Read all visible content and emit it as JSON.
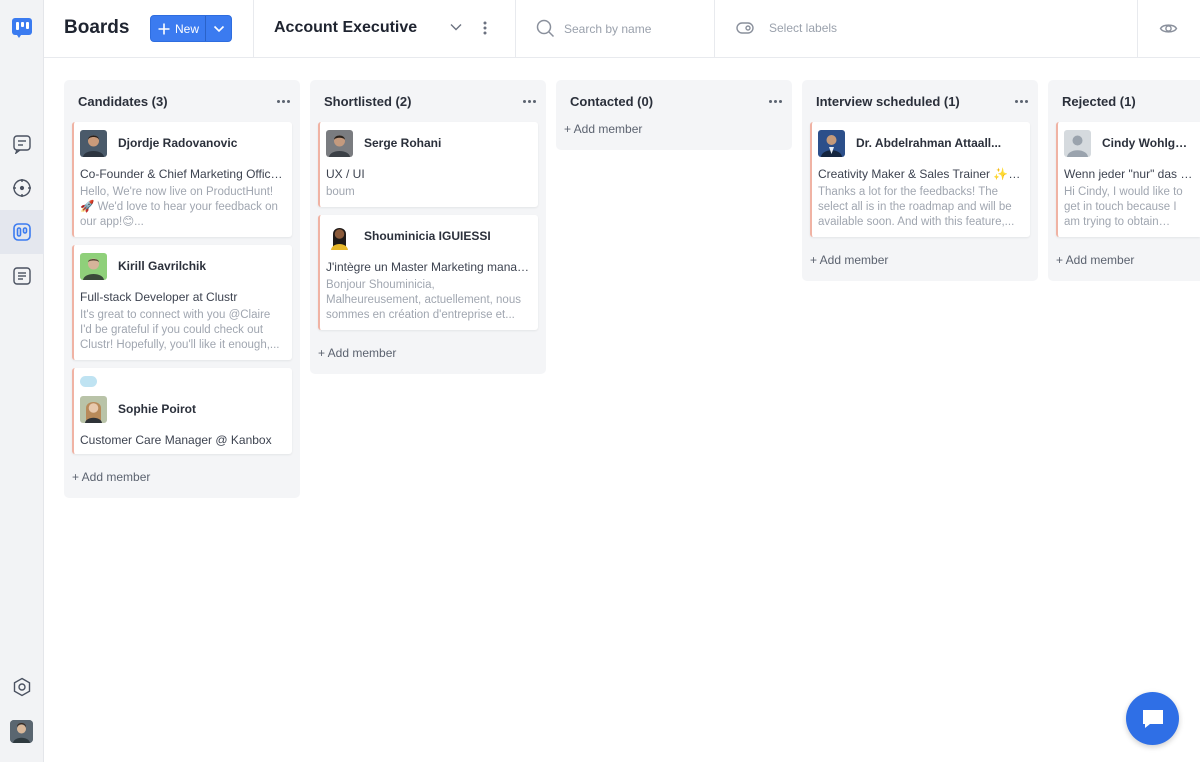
{
  "rail": {
    "icons": [
      "logo-icon",
      "messages-icon",
      "compass-icon",
      "boards-icon",
      "notes-icon",
      "settings-icon"
    ],
    "accent": "#3b7bf0"
  },
  "header": {
    "title": "Boards",
    "new_label": "New",
    "board_name": "Account Executive",
    "search_placeholder": "Search by name",
    "labels_placeholder": "Select labels"
  },
  "columns": [
    {
      "title": "Candidates (3)",
      "add_label": "+ Add member",
      "cards": [
        {
          "name": "Djordje Radovanovic",
          "role": "Co-Founder & Chief Marketing Officer...",
          "message": "Hello, We're now live on ProductHunt! 🚀 We'd love to hear your feedback on our app!😊...",
          "avatar_color": "#4a5a6a"
        },
        {
          "name": "Kirill Gavrilchik",
          "role": "Full-stack Developer at Clustr",
          "message": "It's great to connect with you @Claire I'd be grateful if you could check out Clustr! Hopefully, you'll like it enough,...",
          "avatar_color": "#7fbf6a"
        },
        {
          "name": "Sophie Poirot",
          "role": "Customer Care Manager @ Kanbox",
          "message": "",
          "avatar_color": "#c9a37a",
          "has_label": true
        }
      ]
    },
    {
      "title": "Shortlisted (2)",
      "add_label": "+ Add member",
      "cards": [
        {
          "name": "Serge Rohani",
          "role": "UX / UI",
          "message": "boum",
          "avatar_color": "#6d6e70"
        },
        {
          "name": "Shouminicia IGUIESSI",
          "role": "J'intègre un Master Marketing manag...",
          "message": "Bonjour Shouminicia, Malheureusement, actuellement, nous sommes en création d'entreprise et...",
          "avatar_color": "#e8b82a"
        }
      ]
    },
    {
      "title": "Contacted (0)",
      "add_label": "+ Add member",
      "cards": []
    },
    {
      "title": "Interview scheduled (1)",
      "add_label": "+ Add member",
      "cards": [
        {
          "name": "Dr. Abdelrahman Attaall...",
          "role": "Creativity Maker & Sales Trainer ✨ I ...",
          "message": "Thanks a lot for the feedbacks! The select all is in the roadmap and will be available soon. And with this feature,...",
          "avatar_color": "#2c4f8a"
        }
      ]
    },
    {
      "title": "Rejected (1)",
      "add_label": "+ Add member",
      "cards": [
        {
          "name": "Cindy Wohlgemuth",
          "role": "Wenn jeder \"nur\" das machen würde",
          "message": "Hi Cindy, I would like to get in touch because I am trying to obtain feedback on the use of LinkedIn...",
          "avatar_color": "#aab2bc"
        }
      ]
    }
  ]
}
